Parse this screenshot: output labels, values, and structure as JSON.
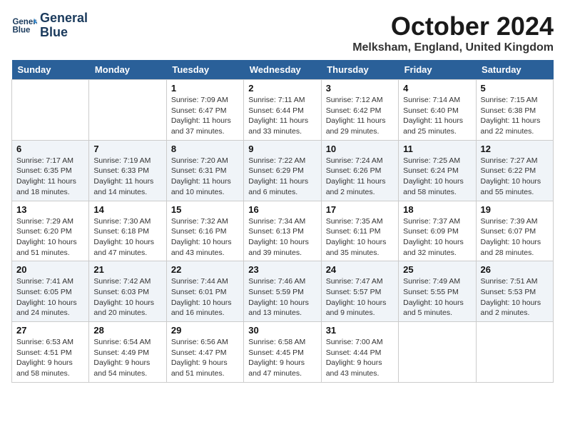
{
  "logo": {
    "line1": "General",
    "line2": "Blue"
  },
  "title": "October 2024",
  "location": "Melksham, England, United Kingdom",
  "days_of_week": [
    "Sunday",
    "Monday",
    "Tuesday",
    "Wednesday",
    "Thursday",
    "Friday",
    "Saturday"
  ],
  "weeks": [
    [
      {
        "date": "",
        "sunrise": "",
        "sunset": "",
        "daylight": ""
      },
      {
        "date": "",
        "sunrise": "",
        "sunset": "",
        "daylight": ""
      },
      {
        "date": "1",
        "sunrise": "Sunrise: 7:09 AM",
        "sunset": "Sunset: 6:47 PM",
        "daylight": "Daylight: 11 hours and 37 minutes."
      },
      {
        "date": "2",
        "sunrise": "Sunrise: 7:11 AM",
        "sunset": "Sunset: 6:44 PM",
        "daylight": "Daylight: 11 hours and 33 minutes."
      },
      {
        "date": "3",
        "sunrise": "Sunrise: 7:12 AM",
        "sunset": "Sunset: 6:42 PM",
        "daylight": "Daylight: 11 hours and 29 minutes."
      },
      {
        "date": "4",
        "sunrise": "Sunrise: 7:14 AM",
        "sunset": "Sunset: 6:40 PM",
        "daylight": "Daylight: 11 hours and 25 minutes."
      },
      {
        "date": "5",
        "sunrise": "Sunrise: 7:15 AM",
        "sunset": "Sunset: 6:38 PM",
        "daylight": "Daylight: 11 hours and 22 minutes."
      }
    ],
    [
      {
        "date": "6",
        "sunrise": "Sunrise: 7:17 AM",
        "sunset": "Sunset: 6:35 PM",
        "daylight": "Daylight: 11 hours and 18 minutes."
      },
      {
        "date": "7",
        "sunrise": "Sunrise: 7:19 AM",
        "sunset": "Sunset: 6:33 PM",
        "daylight": "Daylight: 11 hours and 14 minutes."
      },
      {
        "date": "8",
        "sunrise": "Sunrise: 7:20 AM",
        "sunset": "Sunset: 6:31 PM",
        "daylight": "Daylight: 11 hours and 10 minutes."
      },
      {
        "date": "9",
        "sunrise": "Sunrise: 7:22 AM",
        "sunset": "Sunset: 6:29 PM",
        "daylight": "Daylight: 11 hours and 6 minutes."
      },
      {
        "date": "10",
        "sunrise": "Sunrise: 7:24 AM",
        "sunset": "Sunset: 6:26 PM",
        "daylight": "Daylight: 11 hours and 2 minutes."
      },
      {
        "date": "11",
        "sunrise": "Sunrise: 7:25 AM",
        "sunset": "Sunset: 6:24 PM",
        "daylight": "Daylight: 10 hours and 58 minutes."
      },
      {
        "date": "12",
        "sunrise": "Sunrise: 7:27 AM",
        "sunset": "Sunset: 6:22 PM",
        "daylight": "Daylight: 10 hours and 55 minutes."
      }
    ],
    [
      {
        "date": "13",
        "sunrise": "Sunrise: 7:29 AM",
        "sunset": "Sunset: 6:20 PM",
        "daylight": "Daylight: 10 hours and 51 minutes."
      },
      {
        "date": "14",
        "sunrise": "Sunrise: 7:30 AM",
        "sunset": "Sunset: 6:18 PM",
        "daylight": "Daylight: 10 hours and 47 minutes."
      },
      {
        "date": "15",
        "sunrise": "Sunrise: 7:32 AM",
        "sunset": "Sunset: 6:16 PM",
        "daylight": "Daylight: 10 hours and 43 minutes."
      },
      {
        "date": "16",
        "sunrise": "Sunrise: 7:34 AM",
        "sunset": "Sunset: 6:13 PM",
        "daylight": "Daylight: 10 hours and 39 minutes."
      },
      {
        "date": "17",
        "sunrise": "Sunrise: 7:35 AM",
        "sunset": "Sunset: 6:11 PM",
        "daylight": "Daylight: 10 hours and 35 minutes."
      },
      {
        "date": "18",
        "sunrise": "Sunrise: 7:37 AM",
        "sunset": "Sunset: 6:09 PM",
        "daylight": "Daylight: 10 hours and 32 minutes."
      },
      {
        "date": "19",
        "sunrise": "Sunrise: 7:39 AM",
        "sunset": "Sunset: 6:07 PM",
        "daylight": "Daylight: 10 hours and 28 minutes."
      }
    ],
    [
      {
        "date": "20",
        "sunrise": "Sunrise: 7:41 AM",
        "sunset": "Sunset: 6:05 PM",
        "daylight": "Daylight: 10 hours and 24 minutes."
      },
      {
        "date": "21",
        "sunrise": "Sunrise: 7:42 AM",
        "sunset": "Sunset: 6:03 PM",
        "daylight": "Daylight: 10 hours and 20 minutes."
      },
      {
        "date": "22",
        "sunrise": "Sunrise: 7:44 AM",
        "sunset": "Sunset: 6:01 PM",
        "daylight": "Daylight: 10 hours and 16 minutes."
      },
      {
        "date": "23",
        "sunrise": "Sunrise: 7:46 AM",
        "sunset": "Sunset: 5:59 PM",
        "daylight": "Daylight: 10 hours and 13 minutes."
      },
      {
        "date": "24",
        "sunrise": "Sunrise: 7:47 AM",
        "sunset": "Sunset: 5:57 PM",
        "daylight": "Daylight: 10 hours and 9 minutes."
      },
      {
        "date": "25",
        "sunrise": "Sunrise: 7:49 AM",
        "sunset": "Sunset: 5:55 PM",
        "daylight": "Daylight: 10 hours and 5 minutes."
      },
      {
        "date": "26",
        "sunrise": "Sunrise: 7:51 AM",
        "sunset": "Sunset: 5:53 PM",
        "daylight": "Daylight: 10 hours and 2 minutes."
      }
    ],
    [
      {
        "date": "27",
        "sunrise": "Sunrise: 6:53 AM",
        "sunset": "Sunset: 4:51 PM",
        "daylight": "Daylight: 9 hours and 58 minutes."
      },
      {
        "date": "28",
        "sunrise": "Sunrise: 6:54 AM",
        "sunset": "Sunset: 4:49 PM",
        "daylight": "Daylight: 9 hours and 54 minutes."
      },
      {
        "date": "29",
        "sunrise": "Sunrise: 6:56 AM",
        "sunset": "Sunset: 4:47 PM",
        "daylight": "Daylight: 9 hours and 51 minutes."
      },
      {
        "date": "30",
        "sunrise": "Sunrise: 6:58 AM",
        "sunset": "Sunset: 4:45 PM",
        "daylight": "Daylight: 9 hours and 47 minutes."
      },
      {
        "date": "31",
        "sunrise": "Sunrise: 7:00 AM",
        "sunset": "Sunset: 4:44 PM",
        "daylight": "Daylight: 9 hours and 43 minutes."
      },
      {
        "date": "",
        "sunrise": "",
        "sunset": "",
        "daylight": ""
      },
      {
        "date": "",
        "sunrise": "",
        "sunset": "",
        "daylight": ""
      }
    ]
  ]
}
